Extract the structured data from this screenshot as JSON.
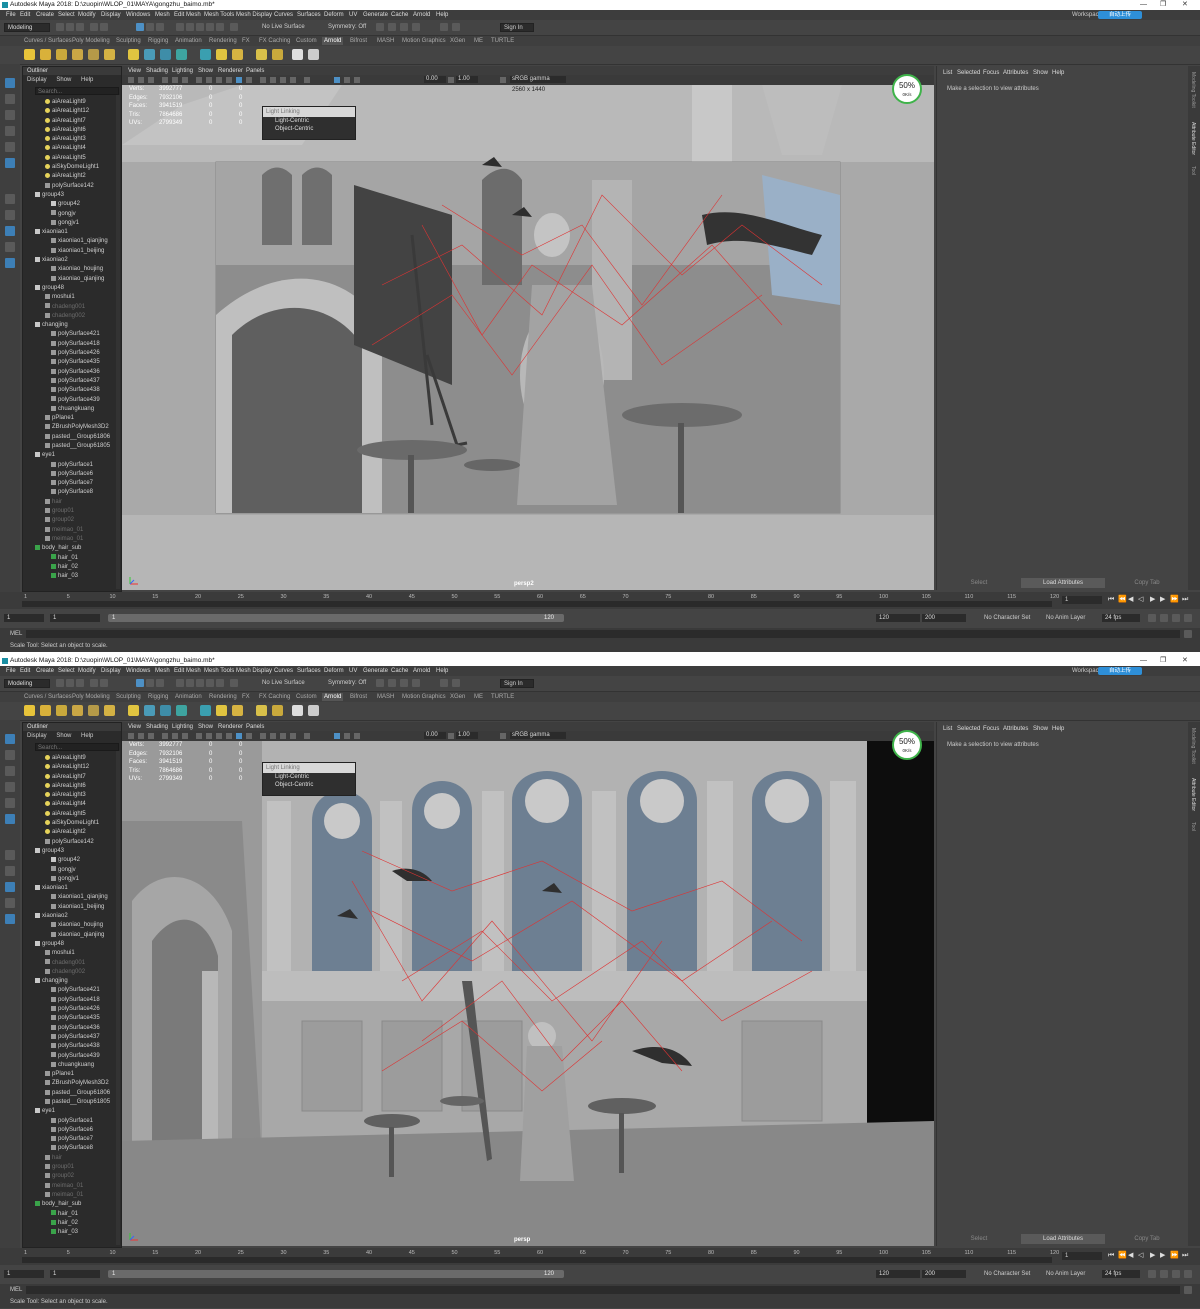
{
  "app": {
    "title": "Autodesk Maya 2018: D:\\zuopin\\WLOP_01\\MAYA\\gongzhu_baimo.mb*",
    "window_controls": [
      "—",
      "❐",
      "✕"
    ]
  },
  "menubar": {
    "items": [
      "File",
      "Edit",
      "Create",
      "Select",
      "Modify",
      "Display",
      "Windows",
      "Mesh",
      "Edit Mesh",
      "Mesh Tools",
      "Mesh Display",
      "Curves",
      "Surfaces",
      "Deform",
      "UV",
      "Generate",
      "Cache",
      "Arnold",
      "Help"
    ],
    "workspace_label": "Workspace :",
    "workspace_button": "自动上传"
  },
  "statusline": {
    "mode": "Modeling",
    "live": "No Live Surface",
    "symmetry": "Symmetry: Off",
    "signin": "Sign In"
  },
  "shelf": {
    "tabs": [
      "Curves / Surfaces",
      "Poly Modeling",
      "Sculpting",
      "Rigging",
      "Animation",
      "Rendering",
      "FX",
      "FX Caching",
      "Custom",
      "Arnold",
      "Bifrost",
      "MASH",
      "Motion Graphics",
      "XGen",
      "ME",
      "TURTLE"
    ],
    "active_tab": "Arnold"
  },
  "outliner": {
    "title": "Outliner",
    "menu": [
      "Display",
      "Show",
      "Help"
    ],
    "search_placeholder": "Search...",
    "items": [
      {
        "label": "aiAreaLight9",
        "kind": "light",
        "depth": 0
      },
      {
        "label": "aiAreaLight12",
        "kind": "light",
        "depth": 0
      },
      {
        "label": "aiAreaLight7",
        "kind": "light",
        "depth": 0
      },
      {
        "label": "aiAreaLight6",
        "kind": "light",
        "depth": 0
      },
      {
        "label": "aiAreaLight3",
        "kind": "light",
        "depth": 0
      },
      {
        "label": "aiAreaLight4",
        "kind": "light",
        "depth": 0
      },
      {
        "label": "aiAreaLight5",
        "kind": "light",
        "depth": 0
      },
      {
        "label": "aiSkyDomeLight1",
        "kind": "light",
        "depth": 0
      },
      {
        "label": "aiAreaLight2",
        "kind": "light",
        "depth": 0
      },
      {
        "label": "polySurface142",
        "kind": "mesh",
        "depth": 0
      },
      {
        "label": "group43",
        "kind": "group",
        "depth": -1
      },
      {
        "label": "group42",
        "kind": "group",
        "depth": 1
      },
      {
        "label": "gongjv",
        "kind": "mesh",
        "depth": 1
      },
      {
        "label": "gongjv1",
        "kind": "mesh",
        "depth": 1
      },
      {
        "label": "xiaoniao1",
        "kind": "group",
        "depth": -1
      },
      {
        "label": "xiaoniao1_qianjing",
        "kind": "mesh",
        "depth": 1
      },
      {
        "label": "xiaoniao1_beijing",
        "kind": "mesh",
        "depth": 1
      },
      {
        "label": "xiaoniao2",
        "kind": "group",
        "depth": -1
      },
      {
        "label": "xiaoniao_houjing",
        "kind": "mesh",
        "depth": 1
      },
      {
        "label": "xiaoniao_qianjing",
        "kind": "mesh",
        "depth": 1
      },
      {
        "label": "group48",
        "kind": "group",
        "depth": -1
      },
      {
        "label": "moshui1",
        "kind": "mesh",
        "depth": 0
      },
      {
        "label": "chadeng001",
        "kind": "hidden",
        "depth": 0
      },
      {
        "label": "chadeng002",
        "kind": "hidden",
        "depth": 0
      },
      {
        "label": "changjing",
        "kind": "group",
        "depth": -1
      },
      {
        "label": "polySurface421",
        "kind": "mesh",
        "depth": 1
      },
      {
        "label": "polySurface418",
        "kind": "mesh",
        "depth": 1
      },
      {
        "label": "polySurface426",
        "kind": "mesh",
        "depth": 1
      },
      {
        "label": "polySurface435",
        "kind": "mesh",
        "depth": 1
      },
      {
        "label": "polySurface436",
        "kind": "mesh",
        "depth": 1
      },
      {
        "label": "polySurface437",
        "kind": "mesh",
        "depth": 1
      },
      {
        "label": "polySurface438",
        "kind": "mesh",
        "depth": 1
      },
      {
        "label": "polySurface439",
        "kind": "mesh",
        "depth": 1
      },
      {
        "label": "chuangkuang",
        "kind": "mesh",
        "depth": 1
      },
      {
        "label": "pPlane1",
        "kind": "mesh",
        "depth": 0
      },
      {
        "label": "ZBrushPolyMesh3D2",
        "kind": "mesh",
        "depth": 0
      },
      {
        "label": "pasted__Group61806",
        "kind": "mesh",
        "depth": 0
      },
      {
        "label": "pasted__Group61805",
        "kind": "mesh",
        "depth": 0
      },
      {
        "label": "eye1",
        "kind": "group",
        "depth": -1
      },
      {
        "label": "polySurface1",
        "kind": "mesh",
        "depth": 1
      },
      {
        "label": "polySurface6",
        "kind": "mesh",
        "depth": 1
      },
      {
        "label": "polySurface7",
        "kind": "mesh",
        "depth": 1
      },
      {
        "label": "polySurface8",
        "kind": "mesh",
        "depth": 1
      },
      {
        "label": "hair",
        "kind": "hidden",
        "depth": 0
      },
      {
        "label": "group01",
        "kind": "hidden",
        "depth": 0
      },
      {
        "label": "group02",
        "kind": "hidden",
        "depth": 0
      },
      {
        "label": "meimao_01",
        "kind": "hidden",
        "depth": 0
      },
      {
        "label": "meimao_01",
        "kind": "hidden",
        "depth": 0
      },
      {
        "label": "body_hair_sub",
        "kind": "hair",
        "depth": -1
      },
      {
        "label": "hair_01",
        "kind": "hair",
        "depth": 1
      },
      {
        "label": "hair_02",
        "kind": "hair",
        "depth": 1
      },
      {
        "label": "hair_03",
        "kind": "hair",
        "depth": 1
      }
    ]
  },
  "viewport": {
    "menu": [
      "View",
      "Shading",
      "Lighting",
      "Show",
      "Renderer",
      "Panels"
    ],
    "exposure": "0.00",
    "gamma_value": "1.00",
    "color_space": "sRGB gamma",
    "hud": [
      {
        "label": "Verts:",
        "value": "3992777",
        "sel": "0",
        "comp": "0"
      },
      {
        "label": "Edges:",
        "value": "7932106",
        "sel": "0",
        "comp": "0"
      },
      {
        "label": "Faces:",
        "value": "3941519",
        "sel": "0",
        "comp": "0"
      },
      {
        "label": "Tris:",
        "value": "7864686",
        "sel": "0",
        "comp": "0"
      },
      {
        "label": "UVs:",
        "value": "2799349",
        "sel": "0",
        "comp": "0"
      }
    ],
    "popup": {
      "title": "Light Linking",
      "items": [
        "Light-Centric",
        "Object-Centric"
      ]
    },
    "fps": {
      "value": "50%",
      "sub": "0K/s"
    }
  },
  "viewport_top": {
    "camera": "persp2",
    "resolution": "2560 x 1440"
  },
  "viewport_bottom": {
    "camera": "persp"
  },
  "attribute_editor": {
    "menu": [
      "List",
      "Selected",
      "Focus",
      "Attributes",
      "Show",
      "Help"
    ],
    "message": "Make a selection to view attributes",
    "buttons": [
      "Select",
      "Load Attributes",
      "Copy Tab"
    ]
  },
  "side_tabs": [
    "Modeling Toolkit",
    "Attribute Editor",
    "Tool"
  ],
  "timeline": {
    "ticks": [
      "1",
      "5",
      "10",
      "15",
      "20",
      "25",
      "30",
      "35",
      "40",
      "45",
      "50",
      "55",
      "60",
      "65",
      "70",
      "75",
      "80",
      "85",
      "90",
      "95",
      "100",
      "105",
      "110",
      "115",
      "120"
    ],
    "current_frame": "1"
  },
  "range": {
    "start": "1",
    "start_inner": "1",
    "slider_start": "1",
    "slider_end": "120",
    "end_inner": "120",
    "end": "200",
    "character_set": "No Character Set",
    "anim_layer": "No Anim Layer",
    "fps": "24 fps"
  },
  "cmdline": {
    "label": "MEL"
  },
  "helpline": {
    "text": "Scale Tool: Select an object to scale."
  }
}
